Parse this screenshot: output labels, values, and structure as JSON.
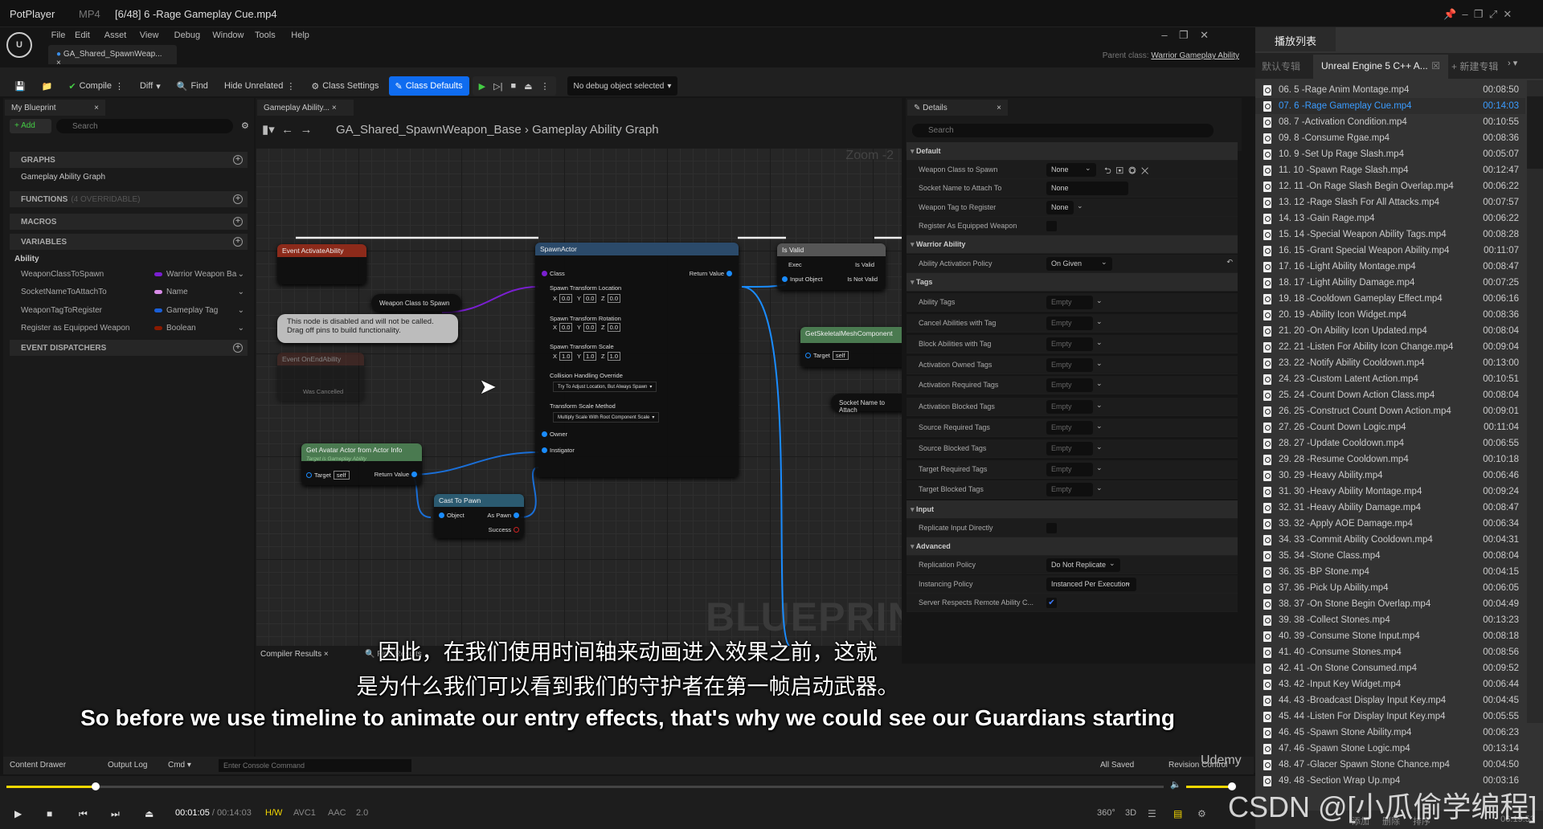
{
  "titlebar": {
    "app": "PotPlayer",
    "format": "MP4",
    "file": "[6/48] 6 -Rage Gameplay Cue.mp4"
  },
  "menu": [
    "File",
    "Edit",
    "Asset",
    "View",
    "Debug",
    "Window",
    "Tools",
    "Help"
  ],
  "doc_tab": "GA_Shared_SpawnWeap...",
  "parent_class_label": "Parent class:",
  "parent_class": "Warrior Gameplay Ability",
  "toolbar": {
    "compile": "Compile",
    "diff": "Diff",
    "find": "Find",
    "hide_unrelated": "Hide Unrelated",
    "class_settings": "Class Settings",
    "class_defaults": "Class Defaults",
    "debug_object": "No debug object selected"
  },
  "my_blueprint": {
    "tab": "My Blueprint",
    "add": "+ Add",
    "search_placeholder": "Search",
    "graphs": "GRAPHS",
    "graph_item": "Gameplay Ability Graph",
    "functions": "FUNCTIONS",
    "functions_note": "(4 OVERRIDABLE)",
    "macros": "MACROS",
    "variables": "VARIABLES",
    "category": "Ability",
    "event_dispatchers": "EVENT DISPATCHERS",
    "vars": [
      {
        "name": "WeaponClassToSpawn",
        "type": "Warrior Weapon Ba",
        "color": "#7a1fd1"
      },
      {
        "name": "SocketNameToAttachTo",
        "type": "Name",
        "color": "#d98ce8"
      },
      {
        "name": "WeaponTagToRegister",
        "type": "Gameplay Tag",
        "color": "#1a5fd8"
      },
      {
        "name": "Register as Equipped Weapon",
        "type": "Boolean",
        "color": "#8a1a00"
      }
    ]
  },
  "graph": {
    "tab": "Gameplay Ability...",
    "breadcrumb_root": "GA_Shared_SpawnWeapon_Base",
    "breadcrumb_leaf": "Gameplay Ability Graph",
    "zoom": "Zoom -2",
    "watermark": "BLUEPRINT",
    "nodes": {
      "event_activate": "Event ActivateAbility",
      "weapon_class_getter": "Weapon Class to Spawn",
      "comment": "This node is disabled and will not be called.\nDrag off pins to build functionality.",
      "event_end": "Event OnEndAbility",
      "was_cancelled": "Was Cancelled",
      "spawn_actor": "SpawnActor",
      "class": "Class",
      "return_value": "Return Value",
      "loc": "Spawn Transform Location",
      "rot": "Spawn Transform Rotation",
      "scale": "Spawn Transform Scale",
      "loc_vals": [
        "0.0",
        "0.0",
        "0.0"
      ],
      "rot_vals": [
        "0.0",
        "0.0",
        "0.0"
      ],
      "scale_vals": [
        "1.0",
        "1.0",
        "1.0"
      ],
      "collision": "Collision Handling Override",
      "collision_val": "Try To Adjust Location, But Always Spawn",
      "scale_method": "Transform Scale Method",
      "scale_method_val": "Multiply Scale With Root Component Scale",
      "owner": "Owner",
      "instigator": "Instigator",
      "get_avatar": "Get Avatar Actor from Actor Info",
      "target_is": "Target is Gameplay Ability",
      "target": "Target",
      "self": "self",
      "cast": "Cast To Pawn",
      "object": "Object",
      "as_pawn": "As Pawn",
      "success": "Success",
      "is_valid": "Is Valid",
      "exec": "Exec",
      "input_object": "Input Object",
      "is_valid_out": "Is Valid",
      "is_not_valid": "Is Not Valid",
      "get_mesh": "GetSkeletalMeshComponent",
      "socket_getter": "Socket Name to Attach"
    }
  },
  "bottom_tabs": {
    "compiler": "Compiler Results",
    "find": "Find Results"
  },
  "details": {
    "tab": "Details",
    "search_placeholder": "Search",
    "rows": [
      {
        "h": "Default"
      },
      {
        "l": "Weapon Class to Spawn",
        "v": "None",
        "k": "combo"
      },
      {
        "l": "Socket Name to Attach To",
        "v": "None",
        "k": "text"
      },
      {
        "l": "Weapon Tag to Register",
        "v": "None",
        "k": "tag"
      },
      {
        "l": "Register As Equipped Weapon",
        "k": "check",
        "checked": false
      },
      {
        "h": "Warrior Ability"
      },
      {
        "l": "Ability Activation Policy",
        "v": "On Given",
        "k": "combo2"
      },
      {
        "h": "Tags"
      },
      {
        "l": "Ability Tags",
        "v": "Empty",
        "k": "empty"
      },
      {
        "l": "Cancel Abilities with Tag",
        "v": "Empty",
        "k": "empty"
      },
      {
        "l": "Block Abilities with Tag",
        "v": "Empty",
        "k": "empty"
      },
      {
        "l": "Activation Owned Tags",
        "v": "Empty",
        "k": "empty"
      },
      {
        "l": "Activation Required Tags",
        "v": "Empty",
        "k": "empty"
      },
      {
        "l": "Activation Blocked Tags",
        "v": "Empty",
        "k": "empty"
      },
      {
        "l": "Source Required Tags",
        "v": "Empty",
        "k": "empty"
      },
      {
        "l": "Source Blocked Tags",
        "v": "Empty",
        "k": "empty"
      },
      {
        "l": "Target Required Tags",
        "v": "Empty",
        "k": "empty"
      },
      {
        "l": "Target Blocked Tags",
        "v": "Empty",
        "k": "empty"
      },
      {
        "h": "Input"
      },
      {
        "l": "Replicate Input Directly",
        "k": "check",
        "checked": false
      },
      {
        "h": "Advanced"
      },
      {
        "l": "Replication Policy",
        "v": "Do Not Replicate",
        "k": "combo3"
      },
      {
        "l": "Instancing Policy",
        "v": "Instanced Per Execution",
        "k": "combo4"
      },
      {
        "l": "Server Respects Remote Ability C...",
        "k": "check",
        "checked": true
      }
    ]
  },
  "status": {
    "content_drawer": "Content Drawer",
    "output_log": "Output Log",
    "cmd": "Cmd",
    "console_placeholder": "Enter Console Command",
    "all_saved": "All Saved",
    "revision": "Revision Control",
    "udemy": "Udemy"
  },
  "subtitles": {
    "zh1": "因此，在我们使用时间轴来动画进入效果之前，这就",
    "zh2": "是为什么我们可以看到我们的守护者在第一帧启动武器。",
    "en": "So before we use timeline to animate our entry effects, that's why we could see our Guardians starting"
  },
  "player": {
    "current": "00:01:05",
    "total": "/ 00:14:03",
    "hw": "H/W",
    "video": "AVC1",
    "audio": "AAC",
    "channels": "2.0",
    "progress_percent": 7.7,
    "volume_percent": 100,
    "accent": "#f5d800",
    "icons": [
      "360-icon",
      "3d-icon",
      "equalizer-icon",
      "playlist-icon",
      "gear-icon"
    ]
  },
  "playlist": {
    "title": "播放列表",
    "tabs": [
      "默认专辑",
      "Unreal Engine 5 C++ A...",
      "+ 新建专辑"
    ],
    "active_index": 1,
    "items": [
      [
        "06. 5 -Rage Anim Montage.mp4",
        "00:08:50"
      ],
      [
        "07. 6 -Rage Gameplay Cue.mp4",
        "00:14:03"
      ],
      [
        "08. 7 -Activation Condition.mp4",
        "00:10:55"
      ],
      [
        "09. 8 -Consume Rgae.mp4",
        "00:08:36"
      ],
      [
        "10. 9 -Set Up Rage Slash.mp4",
        "00:05:07"
      ],
      [
        "11. 10 -Spawn Rage Slash.mp4",
        "00:12:47"
      ],
      [
        "12. 11 -On Rage Slash Begin Overlap.mp4",
        "00:06:22"
      ],
      [
        "13. 12 -Rage Slash For All Attacks.mp4",
        "00:07:57"
      ],
      [
        "14. 13 -Gain Rage.mp4",
        "00:06:22"
      ],
      [
        "15. 14 -Special Weapon Ability Tags.mp4",
        "00:08:28"
      ],
      [
        "16. 15 -Grant Special Weapon Ability.mp4",
        "00:11:07"
      ],
      [
        "17. 16 -Light Ability Montage.mp4",
        "00:08:47"
      ],
      [
        "18. 17 -Light Ability Damage.mp4",
        "00:07:25"
      ],
      [
        "19. 18 -Cooldown Gameplay Effect.mp4",
        "00:06:16"
      ],
      [
        "20. 19 -Ability Icon Widget.mp4",
        "00:08:36"
      ],
      [
        "21. 20 -On Ability Icon Updated.mp4",
        "00:08:04"
      ],
      [
        "22. 21 -Listen For Ability Icon Change.mp4",
        "00:09:04"
      ],
      [
        "23. 22 -Notify Ability Cooldown.mp4",
        "00:13:00"
      ],
      [
        "24. 23 -Custom Latent Action.mp4",
        "00:10:51"
      ],
      [
        "25. 24 -Count Down Action Class.mp4",
        "00:08:04"
      ],
      [
        "26. 25 -Construct Count Down Action.mp4",
        "00:09:01"
      ],
      [
        "27. 26 -Count Down Logic.mp4",
        "00:11:04"
      ],
      [
        "28. 27 -Update Cooldown.mp4",
        "00:06:55"
      ],
      [
        "29. 28 -Resume Cooldown.mp4",
        "00:10:18"
      ],
      [
        "30. 29 -Heavy Ability.mp4",
        "00:06:46"
      ],
      [
        "31. 30 -Heavy Ability Montage.mp4",
        "00:09:24"
      ],
      [
        "32. 31 -Heavy Ability Damage.mp4",
        "00:08:47"
      ],
      [
        "33. 32 -Apply AOE Damage.mp4",
        "00:06:34"
      ],
      [
        "34. 33 -Commit Ability Cooldown.mp4",
        "00:04:31"
      ],
      [
        "35. 34 -Stone Class.mp4",
        "00:08:04"
      ],
      [
        "36. 35 -BP Stone.mp4",
        "00:04:15"
      ],
      [
        "37. 36 -Pick Up Ability.mp4",
        "00:06:05"
      ],
      [
        "38. 37 -On Stone Begin Overlap.mp4",
        "00:04:49"
      ],
      [
        "39. 38 -Collect Stones.mp4",
        "00:13:23"
      ],
      [
        "40. 39 -Consume Stone Input.mp4",
        "00:08:18"
      ],
      [
        "41. 40 -Consume Stones.mp4",
        "00:08:56"
      ],
      [
        "42. 41 -On Stone Consumed.mp4",
        "00:09:52"
      ],
      [
        "43. 42 -Input Key Widget.mp4",
        "00:06:44"
      ],
      [
        "44. 43 -Broadcast Display Input Key.mp4",
        "00:04:45"
      ],
      [
        "45. 44 -Listen For Display Input Key.mp4",
        "00:05:55"
      ],
      [
        "46. 45 -Spawn Stone Ability.mp4",
        "00:06:23"
      ],
      [
        "47. 46 -Spawn Stone Logic.mp4",
        "00:13:14"
      ],
      [
        "48. 47 -Glacer Spawn Stone Chance.mp4",
        "00:04:50"
      ],
      [
        "49. 48 -Section Wrap Up.mp4",
        "00:03:16"
      ]
    ],
    "footer_buttons": [
      "添加",
      "删除",
      "排序"
    ],
    "footer_total": "06:19:53"
  },
  "watermark": "CSDN @[小瓜偷学编程]"
}
